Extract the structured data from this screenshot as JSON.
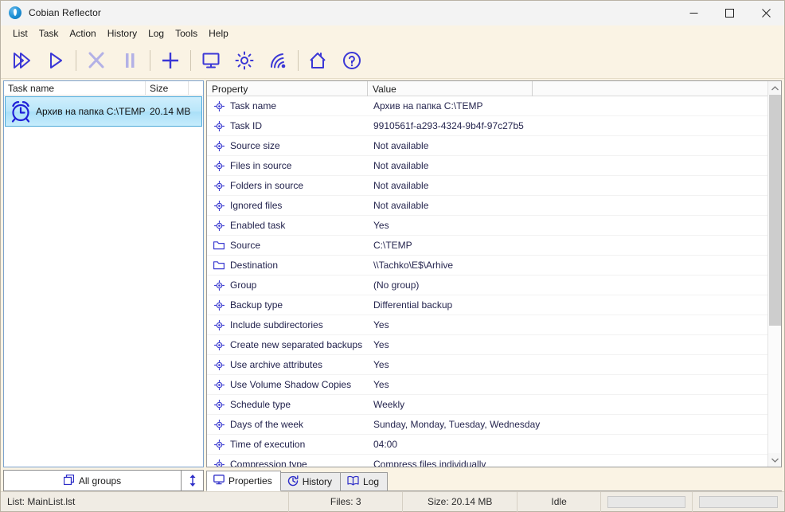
{
  "window": {
    "title": "Cobian Reflector",
    "app_icon": "cobian-logo-icon",
    "minimize": "minimize-icon",
    "maximize": "maximize-icon",
    "close": "close-icon"
  },
  "menu": {
    "items": [
      {
        "label": "List"
      },
      {
        "label": "Task"
      },
      {
        "label": "Action"
      },
      {
        "label": "History"
      },
      {
        "label": "Log"
      },
      {
        "label": "Tools"
      },
      {
        "label": "Help"
      }
    ]
  },
  "toolbar": {
    "buttons": [
      {
        "name": "run-all-tasks-button",
        "icon": "double-play-icon",
        "enabled": true
      },
      {
        "name": "run-selected-task-button",
        "icon": "play-icon",
        "enabled": true
      },
      {
        "name": "stop-button",
        "icon": "close-x-icon",
        "enabled": false
      },
      {
        "name": "pause-button",
        "icon": "pause-icon",
        "enabled": false
      },
      {
        "name": "new-task-button",
        "icon": "plus-icon",
        "enabled": true
      },
      {
        "name": "monitor-button",
        "icon": "monitor-icon",
        "enabled": true
      },
      {
        "name": "options-button",
        "icon": "gear-icon",
        "enabled": true
      },
      {
        "name": "remote-connection-button",
        "icon": "signal-icon",
        "enabled": true
      },
      {
        "name": "home-button",
        "icon": "house-icon",
        "enabled": true
      },
      {
        "name": "help-button",
        "icon": "question-mark-icon",
        "enabled": true
      }
    ]
  },
  "task_list": {
    "columns": [
      {
        "label": "Task name"
      },
      {
        "label": "Size"
      }
    ],
    "rows": [
      {
        "icon": "alarm-clock-icon",
        "name": "Архив на папка C:\\TEMP",
        "size": "20.14 MB",
        "selected": true
      }
    ],
    "groups_button": {
      "label": "All groups",
      "icon": "copy-stack-icon"
    },
    "updown_button": {
      "icon": "up-down-arrow-icon"
    }
  },
  "properties_grid": {
    "columns": [
      {
        "label": "Property"
      },
      {
        "label": "Value"
      },
      {
        "label": ""
      }
    ],
    "rows": [
      {
        "icon": "bullet-target-icon",
        "property": "Task name",
        "value": "Архив на папка C:\\TEMP"
      },
      {
        "icon": "bullet-target-icon",
        "property": "Task ID",
        "value": "9910561f-a293-4324-9b4f-97c27b5"
      },
      {
        "icon": "bullet-target-icon",
        "property": "Source size",
        "value": "Not available"
      },
      {
        "icon": "bullet-target-icon",
        "property": "Files in source",
        "value": "Not available"
      },
      {
        "icon": "bullet-target-icon",
        "property": "Folders in source",
        "value": "Not available"
      },
      {
        "icon": "bullet-target-icon",
        "property": "Ignored files",
        "value": "Not available"
      },
      {
        "icon": "bullet-target-icon",
        "property": "Enabled task",
        "value": "Yes"
      },
      {
        "icon": "folder-icon",
        "property": "Source",
        "value": "C:\\TEMP"
      },
      {
        "icon": "folder-icon",
        "property": "Destination",
        "value": "\\\\Tachko\\E$\\Arhive"
      },
      {
        "icon": "bullet-target-icon",
        "property": "Group",
        "value": "(No group)"
      },
      {
        "icon": "bullet-target-icon",
        "property": "Backup type",
        "value": "Differential backup"
      },
      {
        "icon": "bullet-target-icon",
        "property": "Include subdirectories",
        "value": "Yes"
      },
      {
        "icon": "bullet-target-icon",
        "property": "Create new separated backups",
        "value": "Yes"
      },
      {
        "icon": "bullet-target-icon",
        "property": "Use archive attributes",
        "value": "Yes"
      },
      {
        "icon": "bullet-target-icon",
        "property": "Use Volume Shadow Copies",
        "value": "Yes"
      },
      {
        "icon": "bullet-target-icon",
        "property": "Schedule type",
        "value": "Weekly"
      },
      {
        "icon": "bullet-target-icon",
        "property": "Days of the week",
        "value": "Sunday, Monday, Tuesday, Wednesday"
      },
      {
        "icon": "bullet-target-icon",
        "property": "Time of execution",
        "value": "04:00"
      },
      {
        "icon": "bullet-target-icon",
        "property": "Compression type",
        "value": "Compress files individually"
      }
    ]
  },
  "tabs": [
    {
      "label": "Properties",
      "icon": "monitor-icon",
      "active": true
    },
    {
      "label": "History",
      "icon": "history-clock-icon",
      "active": false
    },
    {
      "label": "Log",
      "icon": "book-icon",
      "active": false
    }
  ],
  "status_bar": {
    "list": "List: MainList.lst",
    "files": "Files: 3",
    "size": "Size: 20.14 MB",
    "state": "Idle",
    "progress_1": "",
    "progress_2": ""
  },
  "colors": {
    "accent_blue": "#2d2ddb",
    "toolbar_bg": "#faf3e4",
    "selection_blue": "#b9e6fa",
    "title_bg": "#f3f3f3",
    "status_bg": "#f0ece4"
  }
}
